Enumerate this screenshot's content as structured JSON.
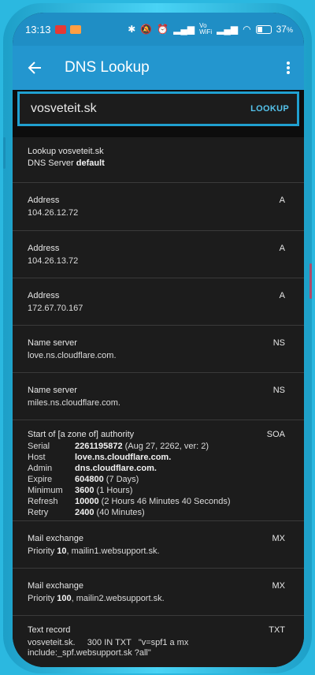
{
  "status": {
    "time": "13:13",
    "battery": "37",
    "icons": [
      "bluetooth-icon",
      "mute-icon",
      "alarm-icon",
      "signal-icon",
      "vowifi-icon",
      "signal-icon-2",
      "wifi-icon",
      "battery-icon"
    ]
  },
  "appbar": {
    "title": "DNS Lookup",
    "back_icon": "back-arrow-icon",
    "menu_icon": "more-vert-icon"
  },
  "search": {
    "value": "vosveteit.sk",
    "button": "LOOKUP"
  },
  "lookup": {
    "line1": "Lookup vosveteit.sk",
    "server_label": "DNS Server",
    "server_value": "default"
  },
  "records": [
    {
      "label": "Address",
      "value": "104.26.12.72",
      "type": "A"
    },
    {
      "label": "Address",
      "value": "104.26.13.72",
      "type": "A"
    },
    {
      "label": "Address",
      "value": "172.67.70.167",
      "type": "A"
    },
    {
      "label": "Name server",
      "value": "love.ns.cloudflare.com.",
      "type": "NS"
    },
    {
      "label": "Name server",
      "value": "miles.ns.cloudflare.com.",
      "type": "NS"
    }
  ],
  "soa": {
    "label": "Start of [a zone of] authority",
    "type": "SOA",
    "fields": [
      {
        "k": "Serial",
        "b": "2261195872",
        "t": " (Aug 27, 2262, ver: 2)"
      },
      {
        "k": "Host",
        "b": "love.ns.cloudflare.com.",
        "t": ""
      },
      {
        "k": "Admin",
        "b": "dns.cloudflare.com.",
        "t": ""
      },
      {
        "k": "Expire",
        "b": "604800",
        "t": " (7 Days)"
      },
      {
        "k": "Minimum",
        "b": "3600",
        "t": " (1 Hours)"
      },
      {
        "k": "Refresh",
        "b": "10000",
        "t": " (2 Hours 46 Minutes 40 Seconds)"
      },
      {
        "k": "Retry",
        "b": "2400",
        "t": " (40 Minutes)"
      }
    ]
  },
  "mx": [
    {
      "label": "Mail exchange",
      "prefix": "Priority ",
      "priority": "10",
      "host": ", mailin1.websupport.sk.",
      "type": "MX"
    },
    {
      "label": "Mail exchange",
      "prefix": "Priority ",
      "priority": "100",
      "host": ", mailin2.websupport.sk.",
      "type": "MX"
    }
  ],
  "txt": {
    "label": "Text record",
    "type": "TXT",
    "line1": "vosveteit.sk.     300 IN TXT   \"v=spf1 a mx",
    "line2": "include:_spf.websupport.sk ?all\""
  }
}
